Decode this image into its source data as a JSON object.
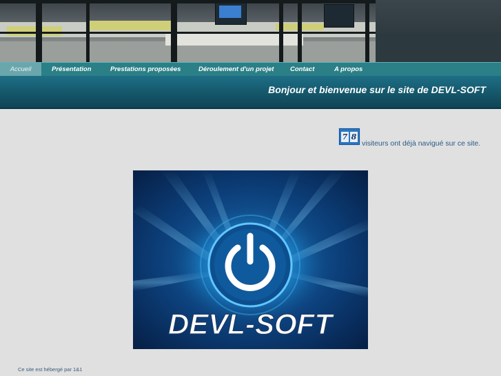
{
  "nav": {
    "items": [
      {
        "label": "Accueil",
        "active": true
      },
      {
        "label": "Présentation",
        "active": false
      },
      {
        "label": "Prestations proposées",
        "active": false
      },
      {
        "label": "Déroulement d'un projet",
        "active": false
      },
      {
        "label": "Contact",
        "active": false
      },
      {
        "label": "A propos",
        "active": false
      }
    ]
  },
  "banner": {
    "title": "Bonjour et bienvenue sur le site de DEVL-SOFT"
  },
  "counter": {
    "digits": [
      "7",
      "8"
    ],
    "text": "visiteurs ont déjà navigué sur ce site."
  },
  "logo": {
    "text": "DEVL-SOFT",
    "icon": "power-icon"
  },
  "footer": {
    "text": "Ce site est hébergé par 1&1"
  },
  "colors": {
    "nav_bg": "#2b7f86",
    "banner_bg": "#16596d",
    "page_bg": "#e0e0e0"
  }
}
